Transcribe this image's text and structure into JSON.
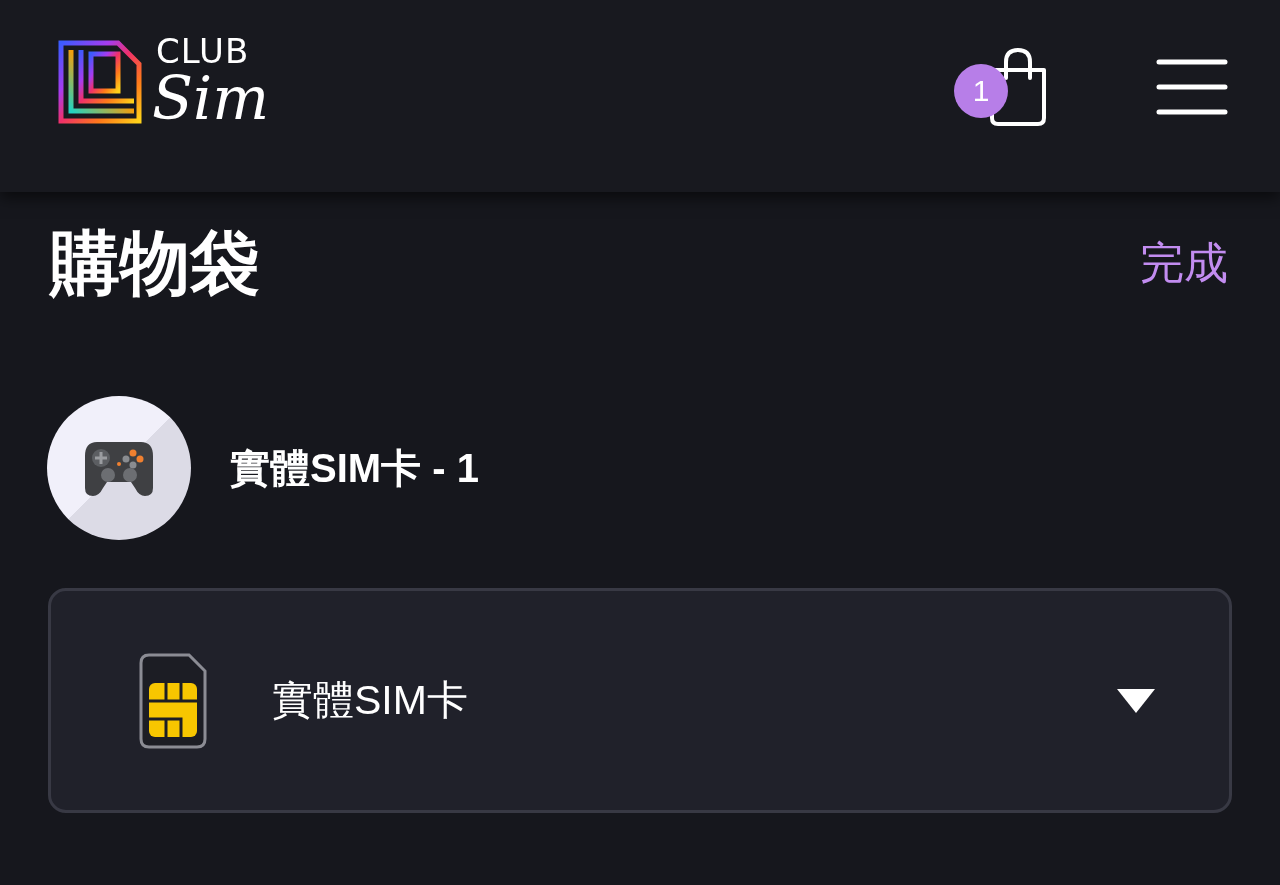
{
  "header": {
    "logo": {
      "line_1": "CLUB",
      "line_2": "Sim"
    },
    "cart": {
      "count": "1"
    }
  },
  "page": {
    "title": "購物袋",
    "action": "完成"
  },
  "cart_items": [
    {
      "name": "實體SIM卡 - 1",
      "option": {
        "value": "實體SIM卡"
      }
    }
  ]
}
